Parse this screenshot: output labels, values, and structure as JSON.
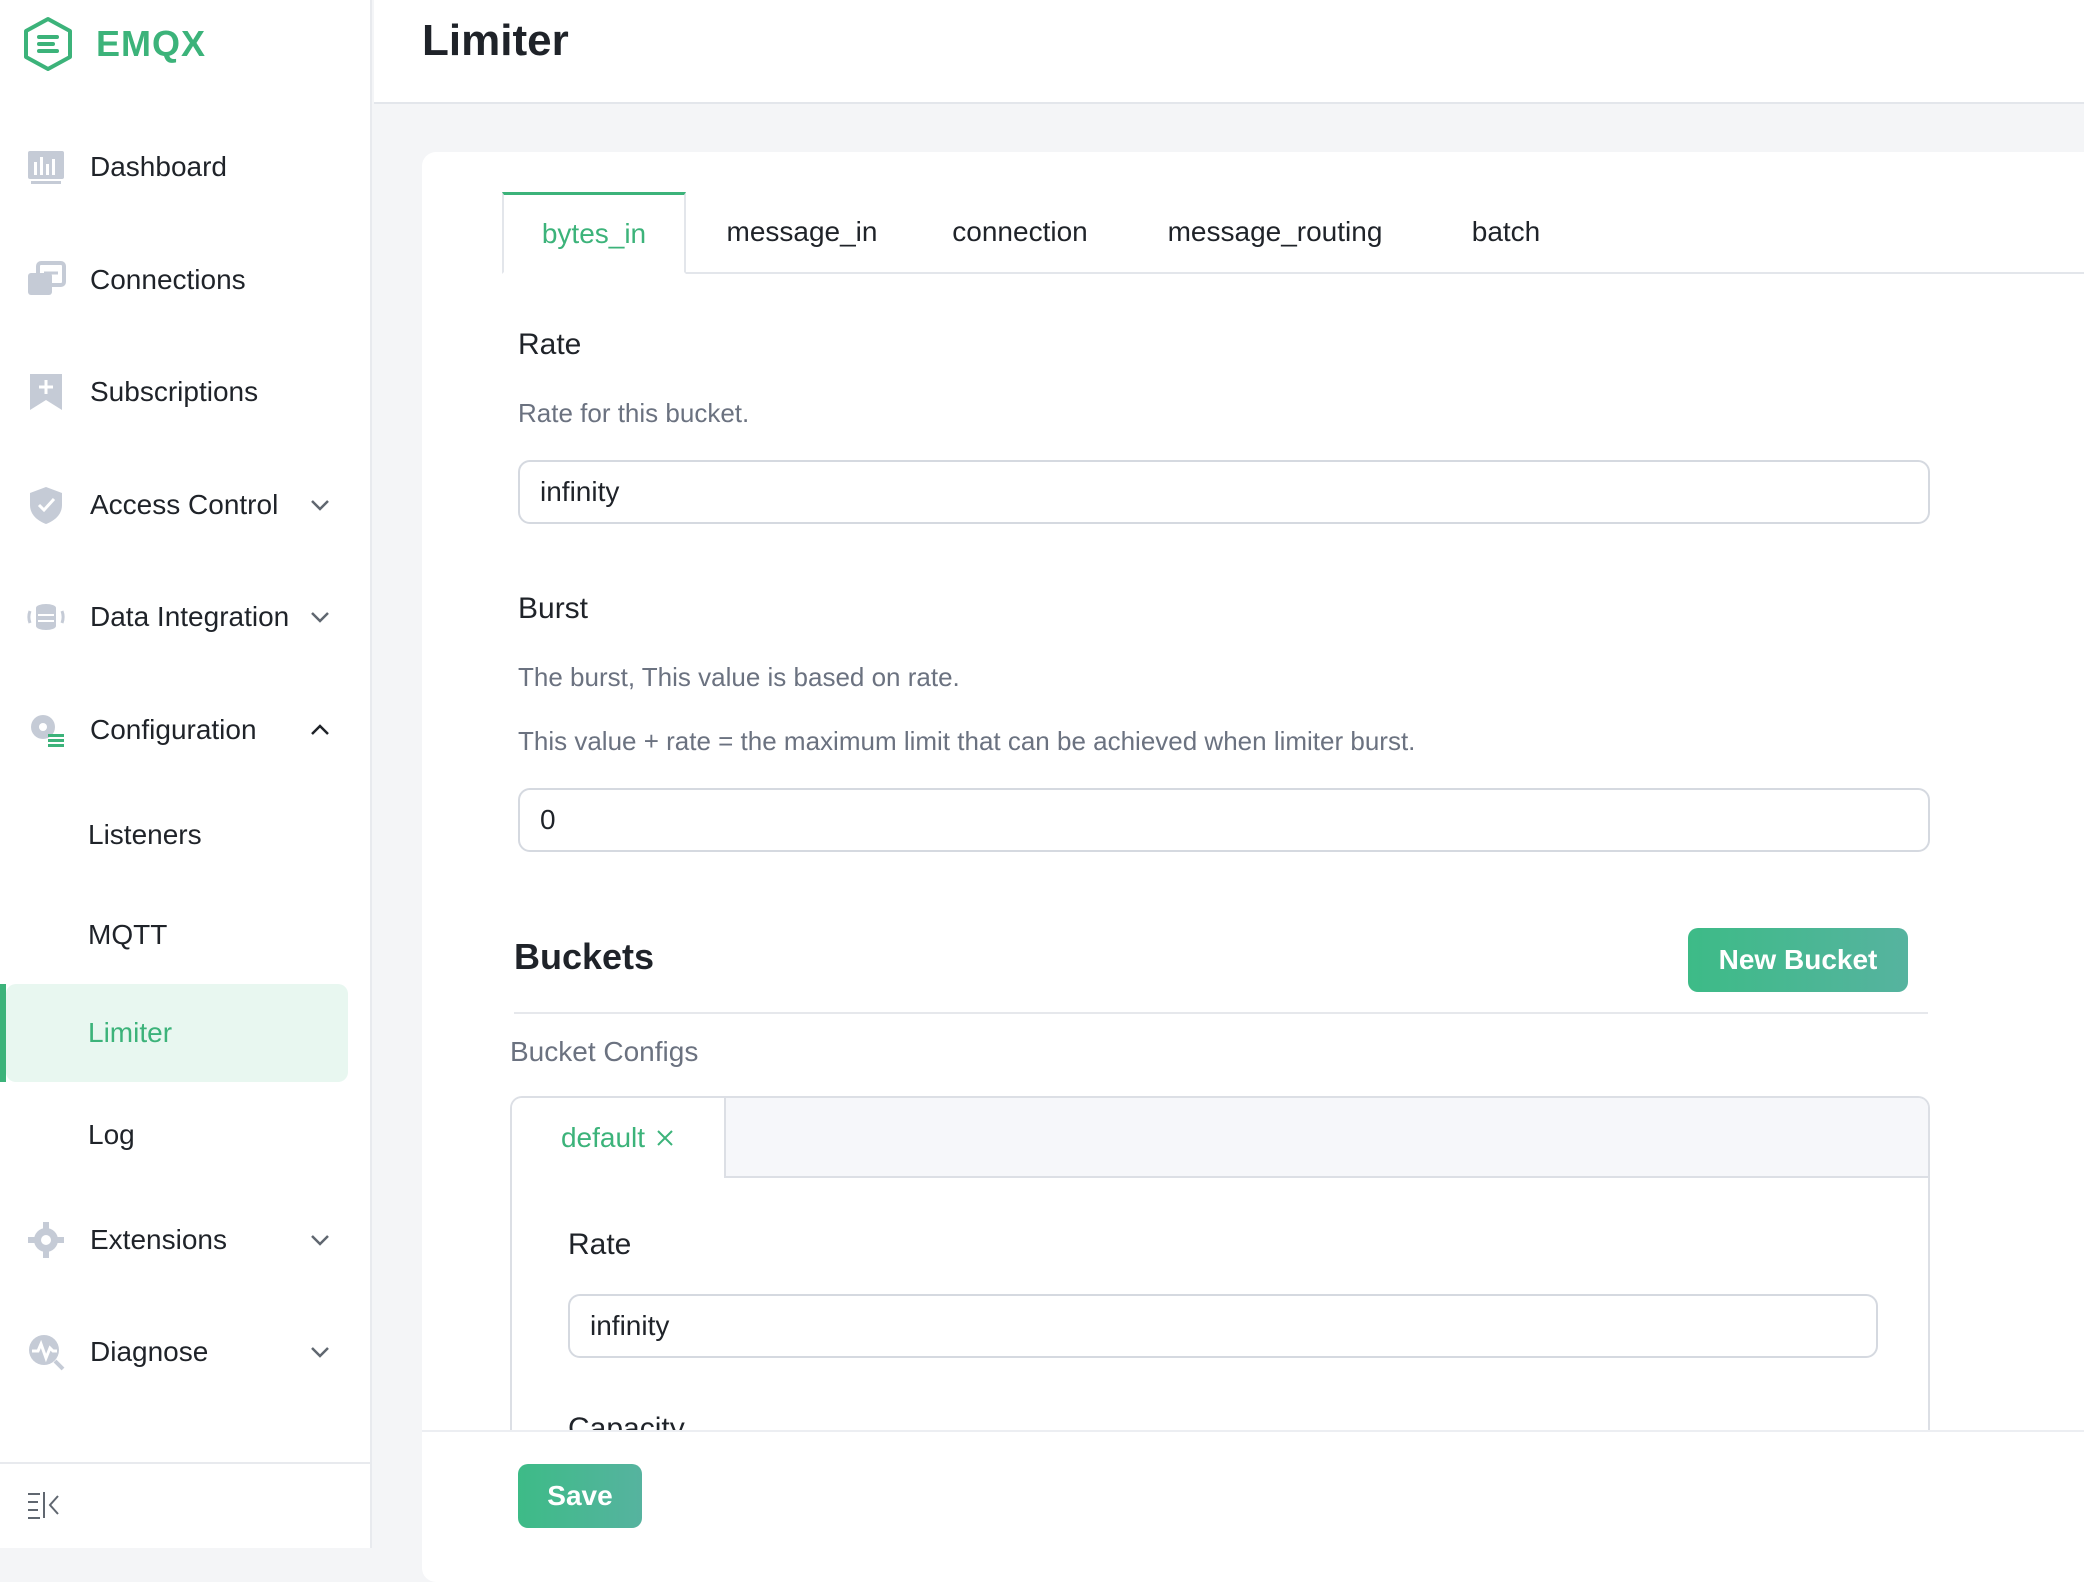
{
  "app": {
    "logo_text": "EMQX"
  },
  "sidebar": {
    "items": [
      {
        "label": "Dashboard",
        "icon": "dashboard-icon"
      },
      {
        "label": "Connections",
        "icon": "connections-icon"
      },
      {
        "label": "Subscriptions",
        "icon": "subscriptions-icon"
      },
      {
        "label": "Access Control",
        "icon": "shield-icon",
        "expandable": true
      },
      {
        "label": "Data Integration",
        "icon": "database-icon",
        "expandable": true
      },
      {
        "label": "Configuration",
        "icon": "gear-icon",
        "expanded": true
      }
    ],
    "config_children": [
      {
        "label": "Listeners"
      },
      {
        "label": "MQTT"
      },
      {
        "label": "Limiter",
        "active": true
      },
      {
        "label": "Log"
      }
    ],
    "items_after": [
      {
        "label": "Extensions",
        "icon": "puzzle-icon",
        "expandable": true
      },
      {
        "label": "Diagnose",
        "icon": "diagnose-icon",
        "expandable": true
      }
    ]
  },
  "header": {
    "title": "Limiter"
  },
  "tabs": [
    {
      "label": "bytes_in",
      "active": true
    },
    {
      "label": "message_in"
    },
    {
      "label": "connection"
    },
    {
      "label": "message_routing"
    },
    {
      "label": "batch"
    }
  ],
  "form": {
    "rate": {
      "label": "Rate",
      "desc": "Rate for this bucket.",
      "value": "infinity"
    },
    "burst": {
      "label": "Burst",
      "desc1": "The burst, This value is based on rate.",
      "desc2": "This value + rate = the maximum limit that can be achieved when limiter burst.",
      "value": "0"
    }
  },
  "buckets": {
    "title": "Buckets",
    "new_button": "New Bucket",
    "configs_label": "Bucket Configs",
    "tab_label": "default",
    "rate_label": "Rate",
    "rate_value": "infinity",
    "capacity_label": "Capacity"
  },
  "footer": {
    "save_label": "Save"
  },
  "colors": {
    "accent": "#3cb37a",
    "accent_bg": "#e8f7f0"
  }
}
